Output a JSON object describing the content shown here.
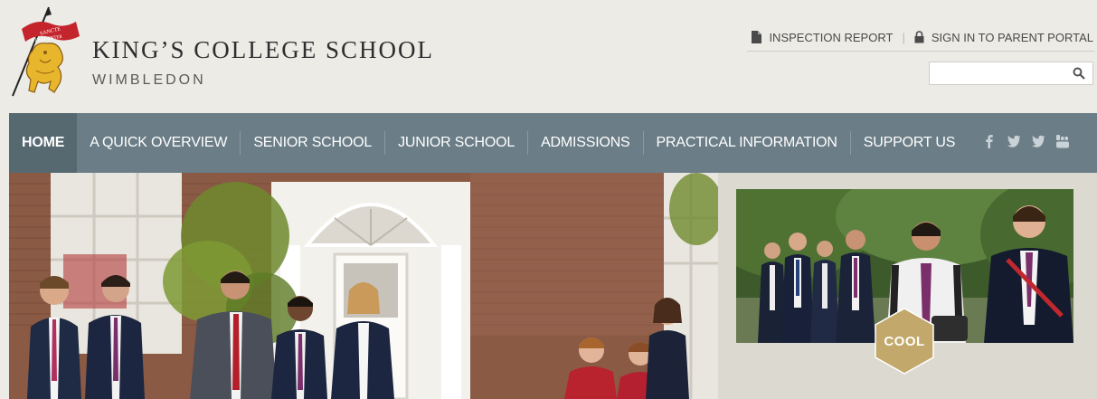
{
  "header": {
    "crest_motto": "SANCTE ET SAPIENTER",
    "school_name": "KING’S COLLEGE SCHOOL",
    "school_subtitle": "WIMBLEDON"
  },
  "utility": {
    "inspection_label": "INSPECTION REPORT",
    "separator": "|",
    "parent_portal_label": "SIGN IN TO PARENT PORTAL",
    "search_placeholder": "",
    "search_value": ""
  },
  "nav": {
    "items": [
      {
        "label": "HOME",
        "active": true
      },
      {
        "label": "A QUICK OVERVIEW"
      },
      {
        "label": "SENIOR SCHOOL"
      },
      {
        "label": "JUNIOR SCHOOL"
      },
      {
        "label": "ADMISSIONS"
      },
      {
        "label": "PRACTICAL INFORMATION"
      },
      {
        "label": "SUPPORT US"
      }
    ],
    "social": [
      "facebook-icon",
      "twitter-icon",
      "twitter-icon",
      "youtube-icon"
    ]
  },
  "feature": {
    "badge_label": "COOL"
  },
  "colors": {
    "nav_bg": "#6b7d86",
    "nav_active_bg": "#566870",
    "page_bg": "#ecebe6",
    "badge_gold": "#c2a86a"
  }
}
